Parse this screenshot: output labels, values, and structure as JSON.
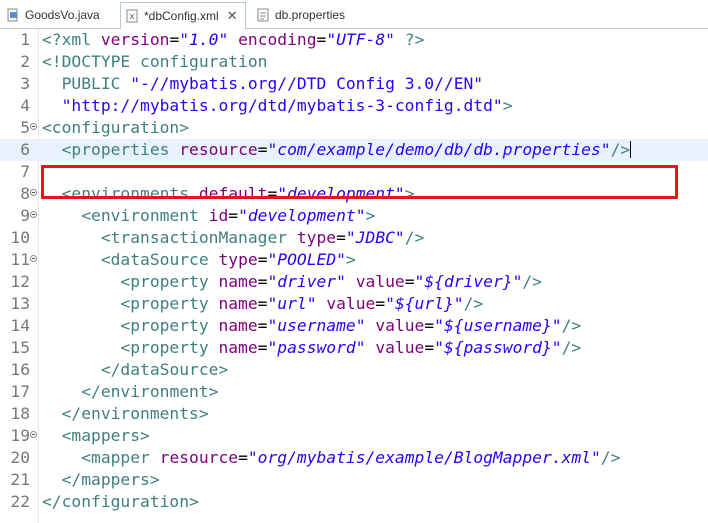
{
  "tabs": [
    {
      "label": "GoodsVo.java",
      "icon": "java-file-icon",
      "active": false
    },
    {
      "label": "*dbConfig.xml",
      "icon": "xml-file-icon",
      "active": true,
      "close": "✕"
    },
    {
      "label": "db.properties",
      "icon": "properties-file-icon",
      "active": false
    }
  ],
  "editor": {
    "current_line": 6,
    "highlighted_line": 6,
    "highlight_color": "#e8141a",
    "lines": [
      {
        "n": "1",
        "fold": false,
        "tokens": [
          [
            "tg",
            "<?xml "
          ],
          [
            "at",
            "version"
          ],
          [
            "pl",
            "="
          ],
          [
            "vl",
            "\"1.0\""
          ],
          [
            "pl",
            " "
          ],
          [
            "at",
            "encoding"
          ],
          [
            "pl",
            "="
          ],
          [
            "vl",
            "\"UTF-8\""
          ],
          [
            "pl",
            " "
          ],
          [
            "tg",
            "?>"
          ]
        ]
      },
      {
        "n": "2",
        "fold": false,
        "tokens": [
          [
            "tg",
            "<!DOCTYPE configuration"
          ]
        ]
      },
      {
        "n": "3",
        "fold": false,
        "tokens": [
          [
            "tg",
            "  PUBLIC "
          ],
          [
            "ds",
            "\"-//mybatis.org//DTD Config 3.0//EN\""
          ]
        ]
      },
      {
        "n": "4",
        "fold": false,
        "tokens": [
          [
            "ds",
            "  \"http://mybatis.org/dtd/mybatis-3-config.dtd\""
          ],
          [
            "tg",
            ">"
          ]
        ]
      },
      {
        "n": "5",
        "fold": true,
        "tokens": [
          [
            "tg",
            "<configuration>"
          ]
        ]
      },
      {
        "n": "6",
        "fold": false,
        "tokens": [
          [
            "pl",
            "  "
          ],
          [
            "tg",
            "<properties "
          ],
          [
            "at",
            "resource"
          ],
          [
            "pl",
            "="
          ],
          [
            "vl",
            "\"com/example/demo/db/db.properties\""
          ],
          [
            "tg",
            "/>"
          ]
        ]
      },
      {
        "n": "7",
        "fold": false,
        "tokens": []
      },
      {
        "n": "8",
        "fold": true,
        "tokens": [
          [
            "pl",
            "  "
          ],
          [
            "tg",
            "<environments "
          ],
          [
            "at",
            "default"
          ],
          [
            "pl",
            "="
          ],
          [
            "vl",
            "\"development\""
          ],
          [
            "tg",
            ">"
          ]
        ]
      },
      {
        "n": "9",
        "fold": true,
        "tokens": [
          [
            "pl",
            "    "
          ],
          [
            "tg",
            "<environment "
          ],
          [
            "at",
            "id"
          ],
          [
            "pl",
            "="
          ],
          [
            "vl",
            "\"development\""
          ],
          [
            "tg",
            ">"
          ]
        ]
      },
      {
        "n": "10",
        "fold": false,
        "tokens": [
          [
            "pl",
            "      "
          ],
          [
            "tg",
            "<transactionManager "
          ],
          [
            "at",
            "type"
          ],
          [
            "pl",
            "="
          ],
          [
            "vl",
            "\"JDBC\""
          ],
          [
            "tg",
            "/>"
          ]
        ]
      },
      {
        "n": "11",
        "fold": true,
        "tokens": [
          [
            "pl",
            "      "
          ],
          [
            "tg",
            "<dataSource "
          ],
          [
            "at",
            "type"
          ],
          [
            "pl",
            "="
          ],
          [
            "vl",
            "\"POOLED\""
          ],
          [
            "tg",
            ">"
          ]
        ]
      },
      {
        "n": "12",
        "fold": false,
        "tokens": [
          [
            "pl",
            "        "
          ],
          [
            "tg",
            "<property "
          ],
          [
            "at",
            "name"
          ],
          [
            "pl",
            "="
          ],
          [
            "vl",
            "\"driver\""
          ],
          [
            "pl",
            " "
          ],
          [
            "at",
            "value"
          ],
          [
            "pl",
            "="
          ],
          [
            "vl",
            "\"${driver}\""
          ],
          [
            "tg",
            "/>"
          ]
        ]
      },
      {
        "n": "13",
        "fold": false,
        "tokens": [
          [
            "pl",
            "        "
          ],
          [
            "tg",
            "<property "
          ],
          [
            "at",
            "name"
          ],
          [
            "pl",
            "="
          ],
          [
            "vl",
            "\"url\""
          ],
          [
            "pl",
            " "
          ],
          [
            "at",
            "value"
          ],
          [
            "pl",
            "="
          ],
          [
            "vl",
            "\"${url}\""
          ],
          [
            "tg",
            "/>"
          ]
        ]
      },
      {
        "n": "14",
        "fold": false,
        "tokens": [
          [
            "pl",
            "        "
          ],
          [
            "tg",
            "<property "
          ],
          [
            "at",
            "name"
          ],
          [
            "pl",
            "="
          ],
          [
            "vl",
            "\"username\""
          ],
          [
            "pl",
            " "
          ],
          [
            "at",
            "value"
          ],
          [
            "pl",
            "="
          ],
          [
            "vl",
            "\"${username}\""
          ],
          [
            "tg",
            "/>"
          ]
        ]
      },
      {
        "n": "15",
        "fold": false,
        "tokens": [
          [
            "pl",
            "        "
          ],
          [
            "tg",
            "<property "
          ],
          [
            "at",
            "name"
          ],
          [
            "pl",
            "="
          ],
          [
            "vl",
            "\"password\""
          ],
          [
            "pl",
            " "
          ],
          [
            "at",
            "value"
          ],
          [
            "pl",
            "="
          ],
          [
            "vl",
            "\"${password}\""
          ],
          [
            "tg",
            "/>"
          ]
        ]
      },
      {
        "n": "16",
        "fold": false,
        "tokens": [
          [
            "pl",
            "      "
          ],
          [
            "tg",
            "</dataSource>"
          ]
        ]
      },
      {
        "n": "17",
        "fold": false,
        "tokens": [
          [
            "pl",
            "    "
          ],
          [
            "tg",
            "</environment>"
          ]
        ]
      },
      {
        "n": "18",
        "fold": false,
        "tokens": [
          [
            "pl",
            "  "
          ],
          [
            "tg",
            "</environments>"
          ]
        ]
      },
      {
        "n": "19",
        "fold": true,
        "tokens": [
          [
            "pl",
            "  "
          ],
          [
            "tg",
            "<mappers>"
          ]
        ]
      },
      {
        "n": "20",
        "fold": false,
        "tokens": [
          [
            "pl",
            "    "
          ],
          [
            "tg",
            "<mapper "
          ],
          [
            "at",
            "resource"
          ],
          [
            "pl",
            "="
          ],
          [
            "vl",
            "\"org/mybatis/example/BlogMapper.xml\""
          ],
          [
            "tg",
            "/>"
          ]
        ]
      },
      {
        "n": "21",
        "fold": false,
        "tokens": [
          [
            "pl",
            "  "
          ],
          [
            "tg",
            "</mappers>"
          ]
        ]
      },
      {
        "n": "22",
        "fold": false,
        "tokens": [
          [
            "tg",
            "</configuration>"
          ]
        ]
      }
    ]
  }
}
